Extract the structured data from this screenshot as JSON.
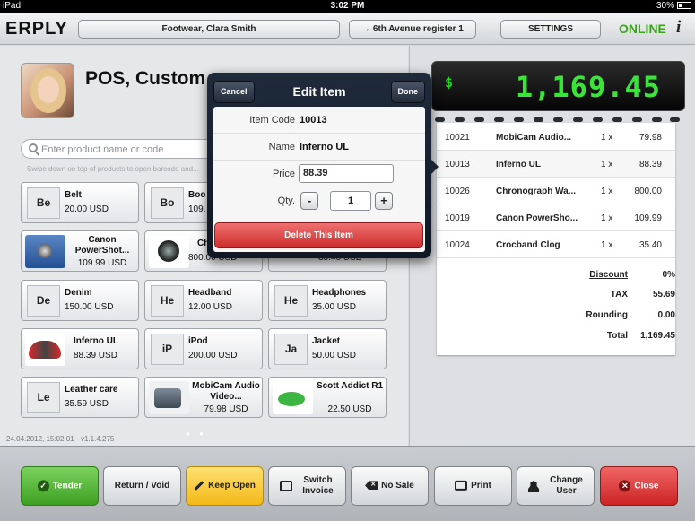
{
  "status_bar": {
    "device": "iPad",
    "time": "3:02 PM",
    "battery": "30%"
  },
  "topbar": {
    "logo": "ERPLY",
    "location_user": "Footwear, Clara Smith",
    "register": "→ 6th Avenue register 1",
    "settings": "SETTINGS",
    "online": "ONLINE",
    "info": "i"
  },
  "customer": {
    "title": "POS, Custom"
  },
  "search": {
    "placeholder": "Enter product name or code",
    "hint": "Swipe down on top of products to open barcode and..."
  },
  "products": [
    {
      "abbr": "Be",
      "name": "Belt",
      "price": "20.00 USD"
    },
    {
      "abbr": "Bo",
      "name": "Boo",
      "price": "109."
    },
    {
      "name": "Canon PowerShot...",
      "price": "109.99 USD"
    },
    {
      "name": "Ch",
      "price": "800.00 USD"
    },
    {
      "name": "",
      "price": "35.40 USD"
    },
    {
      "abbr": "De",
      "name": "Denim",
      "price": "150.00 USD"
    },
    {
      "abbr": "He",
      "name": "Headband",
      "price": "12.00 USD"
    },
    {
      "abbr": "He",
      "name": "Headphones",
      "price": "35.00 USD"
    },
    {
      "name": "Inferno UL",
      "price": "88.39 USD"
    },
    {
      "abbr": "iP",
      "name": "iPod",
      "price": "200.00 USD"
    },
    {
      "abbr": "Ja",
      "name": "Jacket",
      "price": "50.00 USD"
    },
    {
      "abbr": "Le",
      "name": "Leather care",
      "price": "35.59 USD"
    },
    {
      "name": "MobiCam Audio Video...",
      "price": "79.98 USD"
    },
    {
      "name": "Scott Addict R1",
      "price": "22.50 USD"
    }
  ],
  "footer": {
    "timestamp": "24.04.2012, 15:02:01",
    "version": "v1.1.4.275",
    "page_dots": "● ●"
  },
  "display": {
    "currency": "$",
    "total": "1,169.45"
  },
  "receipt": {
    "rows": [
      {
        "code": "10021",
        "name": "MobiCam Audio...",
        "qty": "1 x",
        "amount": "79.98"
      },
      {
        "code": "10013",
        "name": "Inferno UL",
        "qty": "1 x",
        "amount": "88.39"
      },
      {
        "code": "10026",
        "name": "Chronograph Wa...",
        "qty": "1 x",
        "amount": "800.00"
      },
      {
        "code": "10019",
        "name": "Canon PowerSho...",
        "qty": "1 x",
        "amount": "109.99"
      },
      {
        "code": "10024",
        "name": "Crocband Clog",
        "qty": "1 x",
        "amount": "35.40"
      }
    ],
    "discount_label": "Discount",
    "discount": "0%",
    "tax_label": "TAX",
    "tax": "55.69",
    "rounding_label": "Rounding",
    "rounding": "0.00",
    "total_label": "Total",
    "total": "1,169.45"
  },
  "edit_item": {
    "title": "Edit Item",
    "cancel": "Cancel",
    "done": "Done",
    "code_label": "Item Code",
    "code": "10013",
    "name_label": "Name",
    "name": "Inferno UL",
    "price_label": "Price",
    "price": "88.39",
    "qty_label": "Qty.",
    "qty": "1",
    "minus": "-",
    "plus": "+",
    "delete": "Delete This Item"
  },
  "bottom_buttons": {
    "tender": "Tender",
    "return_void": "Return / Void",
    "keep_open": "Keep Open",
    "switch_invoice": "Switch Invoice",
    "no_sale": "No Sale",
    "print": "Print",
    "change_user": "Change User",
    "close": "Close"
  },
  "colors": {
    "online": "#3aa51c",
    "display_digits": "#37e637",
    "tender": "#4cb52d",
    "keep_open": "#f5c21f",
    "close": "#d93333",
    "delete": "#e04848"
  }
}
